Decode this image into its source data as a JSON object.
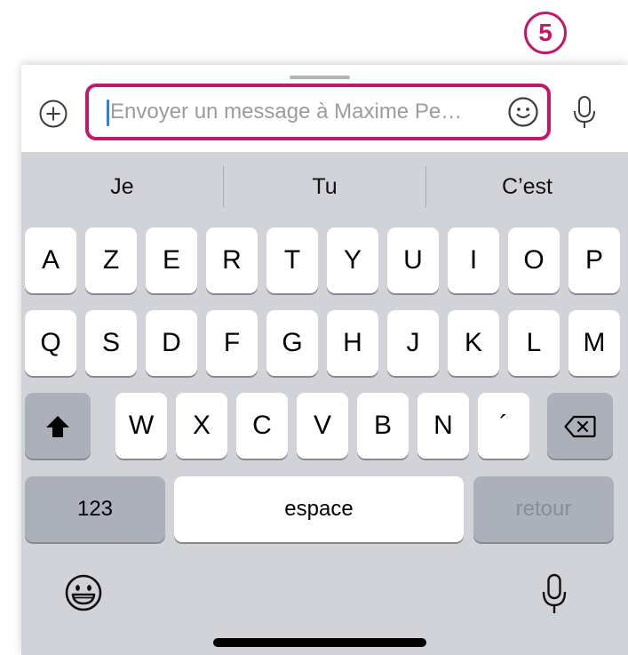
{
  "step_badge": "5",
  "composer": {
    "placeholder": "Envoyer un message à Maxime Pe…",
    "value": "",
    "plus_icon": "plus-circle-icon",
    "emoji_icon": "smiley-icon",
    "mic_icon": "microphone-icon"
  },
  "suggestions": [
    "Je",
    "Tu",
    "C’est"
  ],
  "keyboard": {
    "row1": [
      "A",
      "Z",
      "E",
      "R",
      "T",
      "Y",
      "U",
      "I",
      "O",
      "P"
    ],
    "row2": [
      "Q",
      "S",
      "D",
      "F",
      "G",
      "H",
      "J",
      "K",
      "L",
      "M"
    ],
    "row3": [
      "W",
      "X",
      "C",
      "V",
      "B",
      "N",
      "´"
    ],
    "shift_icon": "shift-arrow-icon",
    "delete_icon": "backspace-icon",
    "numbers_label": "123",
    "space_label": "espace",
    "return_label": "retour",
    "emoji_icon": "emoji-keyboard-icon",
    "dictation_icon": "dictation-microphone-icon"
  },
  "colors": {
    "highlight": "#c2186b",
    "keyboard_bg": "#d1d3d9",
    "key_bg": "#ffffff",
    "dark_key_bg": "#abb0ba",
    "cursor": "#3a7bd5"
  }
}
